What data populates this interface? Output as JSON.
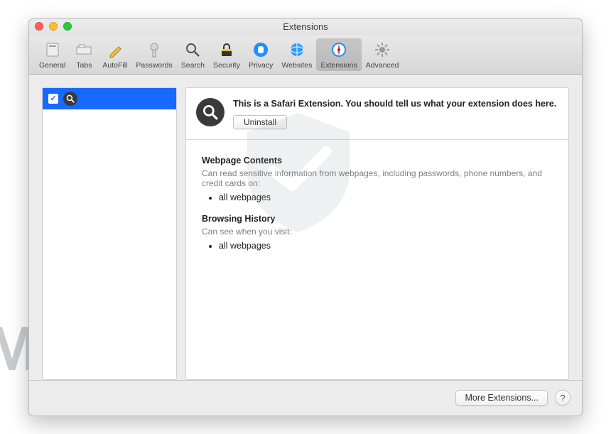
{
  "window": {
    "title": "Extensions"
  },
  "toolbar": {
    "items": [
      {
        "label": "General"
      },
      {
        "label": "Tabs"
      },
      {
        "label": "AutoFill"
      },
      {
        "label": "Passwords"
      },
      {
        "label": "Search"
      },
      {
        "label": "Security"
      },
      {
        "label": "Privacy"
      },
      {
        "label": "Websites"
      },
      {
        "label": "Extensions"
      },
      {
        "label": "Advanced"
      }
    ]
  },
  "sidebar": {
    "extension": {
      "checked": true
    }
  },
  "detail": {
    "description": "This is a Safari Extension. You should tell us what your extension does here.",
    "uninstall_label": "Uninstall",
    "sections": {
      "webpage_title": "Webpage Contents",
      "webpage_desc": "Can read sensitive information from webpages, including passwords, phone numbers, and credit cards on:",
      "webpage_bullet": "all webpages",
      "history_title": "Browsing History",
      "history_desc": "Can see when you visit:",
      "history_bullet": "all webpages"
    }
  },
  "footer": {
    "more_label": "More Extensions...",
    "help_label": "?"
  },
  "watermark": "MALWARETIPS"
}
